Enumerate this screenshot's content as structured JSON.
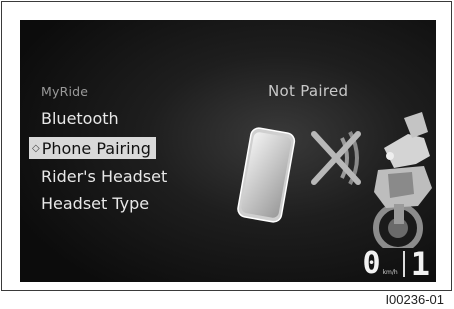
{
  "menu": {
    "section_title": "MyRide",
    "items": [
      {
        "label": "Bluetooth",
        "selected": false
      },
      {
        "label": "Phone Pairing",
        "selected": true,
        "icon": "diamond-outline-icon"
      },
      {
        "label": "Rider's Headset",
        "selected": false
      },
      {
        "label": "Headset Type",
        "selected": false
      }
    ]
  },
  "pairing": {
    "status": "Not Paired",
    "icons": [
      "smartphone-icon",
      "no-signal-cross-icon",
      "motorcycle-image"
    ]
  },
  "dashboard": {
    "speed": "0",
    "speed_unit": "km/h",
    "gear": "1"
  },
  "figure_code": "I00236-01",
  "colors": {
    "screen_bg": "#0c0c0c",
    "highlight_bg": "#d9d9d9",
    "text": "#e8e8e8"
  }
}
